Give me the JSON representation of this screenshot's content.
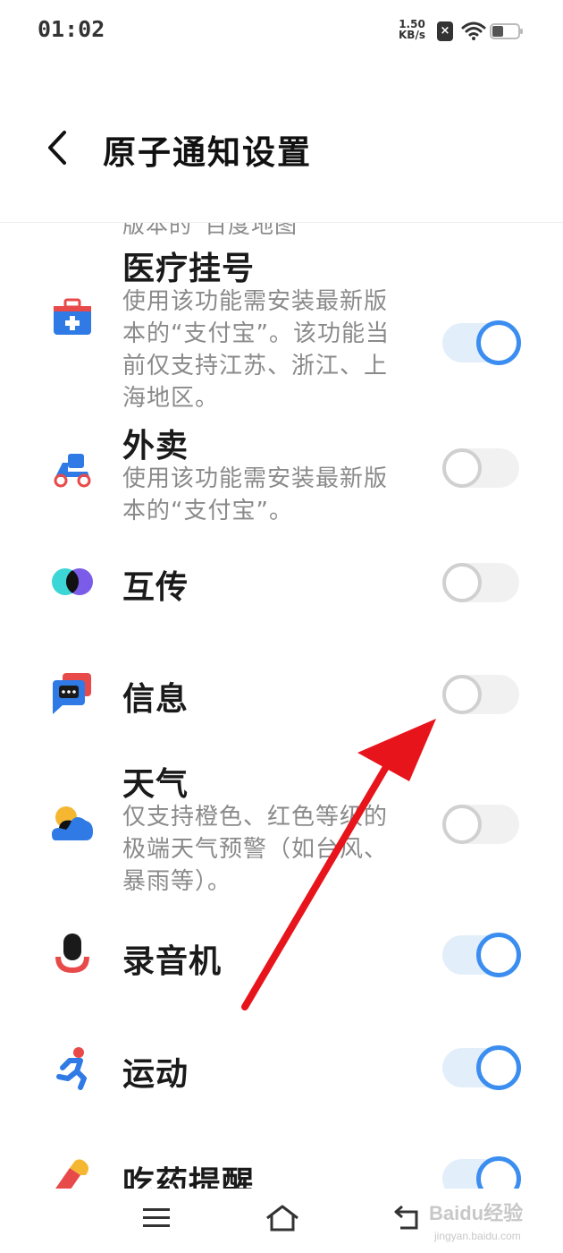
{
  "status_bar": {
    "time": "01:02",
    "net_speed": "1.50",
    "net_unit": "KB/s",
    "x_badge": "×"
  },
  "header": {
    "title": "原子通知设置",
    "back_icon": "chevron-left-icon"
  },
  "partial_item_text": "版本的“百度地图”",
  "items": [
    {
      "title": "医疗挂号",
      "desc": "使用该功能需安装最新版本的“支付宝”。该功能当前仅支持江苏、浙江、上海地区。",
      "icon": "medical-kit-icon",
      "enabled": true
    },
    {
      "title": "外卖",
      "desc": "使用该功能需安装最新版本的“支付宝”。",
      "icon": "delivery-scooter-icon",
      "enabled": false
    },
    {
      "title": "互传",
      "desc": "",
      "icon": "share-circles-icon",
      "enabled": false
    },
    {
      "title": "信息",
      "desc": "",
      "icon": "message-bubble-icon",
      "enabled": false
    },
    {
      "title": "天气",
      "desc": "仅支持橙色、红色等级的极端天气预警（如台风、暴雨等）。",
      "icon": "weather-sun-cloud-icon",
      "enabled": false
    },
    {
      "title": "录音机",
      "desc": "",
      "icon": "microphone-icon",
      "enabled": true
    },
    {
      "title": "运动",
      "desc": "",
      "icon": "running-person-icon",
      "enabled": true
    },
    {
      "title": "吃药提醒",
      "desc": "",
      "icon": "pill-icon",
      "enabled": true
    }
  ],
  "nav_bar": {
    "menu_icon": "menu-icon",
    "home_icon": "home-icon",
    "back_icon": "back-return-icon"
  },
  "watermark": {
    "main": "Baidu经验",
    "sub": "jingyan.baidu.com"
  },
  "colors": {
    "accent": "#3b8df0",
    "toggle_on_track": "#e3eefb",
    "toggle_off_track": "#f1f1f1",
    "arrow": "#e8141c"
  }
}
